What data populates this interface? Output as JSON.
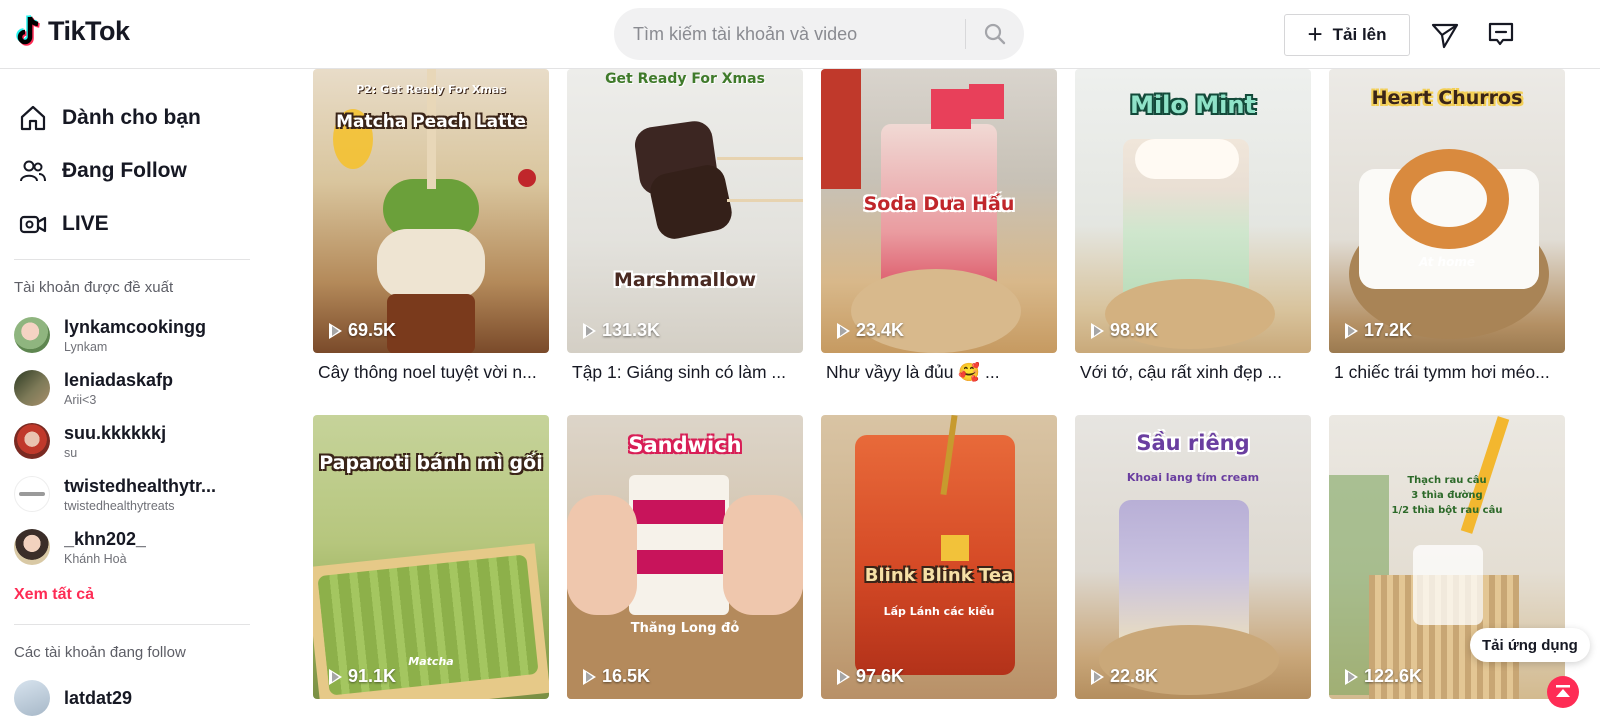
{
  "brand": {
    "name": "TikTok"
  },
  "search": {
    "placeholder": "Tìm kiếm tài khoản và video"
  },
  "header": {
    "upload_label": "Tải lên"
  },
  "nav": [
    {
      "label": "Dành cho bạn",
      "icon": "home-icon"
    },
    {
      "label": "Đang Follow",
      "icon": "following-icon"
    },
    {
      "label": "LIVE",
      "icon": "live-icon"
    }
  ],
  "suggested": {
    "title": "Tài khoản được đề xuất",
    "accounts": [
      {
        "username": "lynkamcookingg",
        "name": "Lynkam"
      },
      {
        "username": "leniadaskafp",
        "name": "Arii<3"
      },
      {
        "username": "suu.kkkkkkj",
        "name": "su"
      },
      {
        "username": "twistedhealthytr...",
        "name": "twistedhealthytreats"
      },
      {
        "username": "_khn202_",
        "name": "Khánh Hoà"
      }
    ],
    "see_all": "Xem tất cả"
  },
  "following": {
    "title": "Các tài khoản đang follow",
    "accounts": [
      {
        "username": "latdat29"
      }
    ]
  },
  "videos": [
    {
      "views": "69.5K",
      "caption": "Cây thông noel tuyệt vời n...",
      "overlay": "Matcha Peach Latte",
      "overlay_top": "P2: Get Ready For Xmas"
    },
    {
      "views": "131.3K",
      "caption": "Tập 1: Giáng sinh có làm ...",
      "overlay": "Marshmallow",
      "overlay_top": "Get Ready For Xmas"
    },
    {
      "views": "23.4K",
      "caption": "Như vầyy là đủu 🥰 ...",
      "overlay": "Soda Dưa Hấu"
    },
    {
      "views": "98.9K",
      "caption": "Với tớ, cậu rất xinh đẹp ...",
      "overlay": "Milo Mint"
    },
    {
      "views": "17.2K",
      "caption": "1 chiếc trái tymm hơi méo...",
      "overlay": "Heart Churros",
      "overlay_sub": "At home"
    },
    {
      "views": "91.1K",
      "overlay": "Paparoti bánh mì gối",
      "overlay_sub": "Matcha"
    },
    {
      "views": "16.5K",
      "overlay": "Sandwich",
      "overlay_sub": "Thăng Long đỏ"
    },
    {
      "views": "97.6K",
      "overlay": "Blink Blink Tea",
      "overlay_sub": "Lấp Lánh các kiểu"
    },
    {
      "views": "22.8K",
      "overlay": "Sầu riêng",
      "overlay_sub": "Khoai lang tím cream"
    },
    {
      "views": "122.6K",
      "overlay_lines": [
        "Thạch rau câu",
        "3 thìa đường",
        "1/2 thìa bột rau câu"
      ]
    }
  ],
  "get_app": "Tải ứng dụng",
  "colors": {
    "accent": "#fe2c55",
    "text": "#161823",
    "muted": "#8a8b91"
  }
}
